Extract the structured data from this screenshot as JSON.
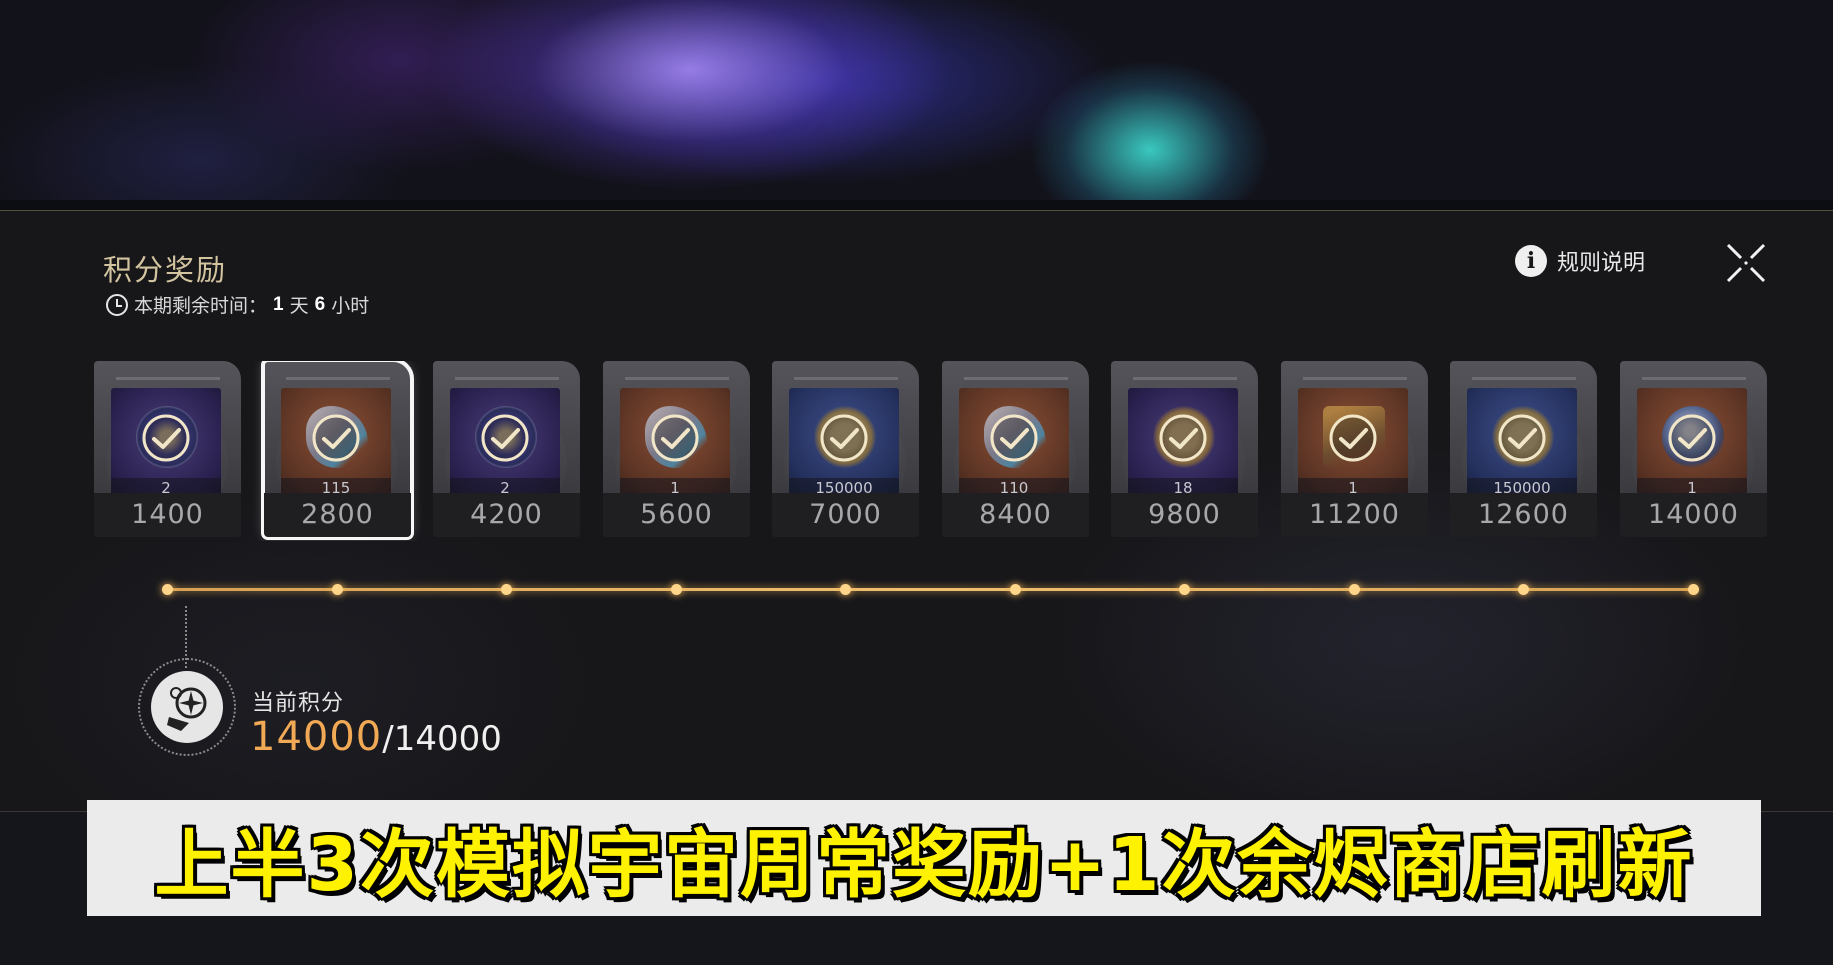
{
  "panel": {
    "title": "积分奖励",
    "timer": {
      "label": "本期剩余时间：",
      "days": "1",
      "days_unit": "天",
      "hours": "6",
      "hours_unit": "小时"
    },
    "rules_label": "规则说明"
  },
  "rewards": [
    {
      "points": "1400",
      "qty": "2",
      "art": "disc",
      "theme": "purple",
      "claimed": true
    },
    {
      "points": "2800",
      "qty": "115",
      "art": "crystal",
      "theme": "brown",
      "claimed": true,
      "selected": true
    },
    {
      "points": "4200",
      "qty": "2",
      "art": "disc",
      "theme": "purple",
      "claimed": true
    },
    {
      "points": "5600",
      "qty": "1",
      "art": "crystal",
      "theme": "brown",
      "claimed": true
    },
    {
      "points": "7000",
      "qty": "150000",
      "art": "coin",
      "theme": "blue",
      "claimed": true
    },
    {
      "points": "8400",
      "qty": "110",
      "art": "crystal",
      "theme": "brown",
      "claimed": true
    },
    {
      "points": "9800",
      "qty": "18",
      "art": "coin",
      "theme": "purple",
      "claimed": true
    },
    {
      "points": "11200",
      "qty": "1",
      "art": "box",
      "theme": "brown",
      "claimed": true
    },
    {
      "points": "12600",
      "qty": "150000",
      "art": "coin",
      "theme": "blue",
      "claimed": true
    },
    {
      "points": "14000",
      "qty": "1",
      "art": "orb",
      "theme": "brown",
      "claimed": true
    }
  ],
  "progress": {
    "label": "当前积分",
    "current": "14000",
    "max": "/14000"
  },
  "caption": "上半3次模拟宇宙周常奖励+1次余烬商店刷新",
  "colors": {
    "accent_gold": "#d3c4a0",
    "score_orange": "#f2a955",
    "track": "#f0c070",
    "caption_yellow": "#fff200"
  }
}
